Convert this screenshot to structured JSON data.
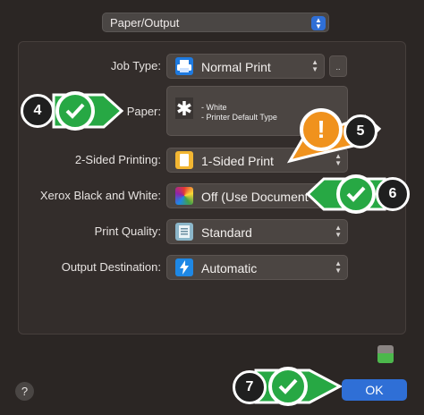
{
  "header": {
    "section_select": "Paper/Output"
  },
  "form": {
    "job_type": {
      "label": "Job Type:",
      "value": "Normal Print",
      "extra_button": ".."
    },
    "paper": {
      "label": "Paper:",
      "line1": "- White",
      "line2": "- Printer Default Type",
      "icon": "asterisk-icon"
    },
    "two_sided": {
      "label": "2-Sided Printing:",
      "value": "1-Sided Print"
    },
    "xerox_bw": {
      "label": "Xerox Black and White:",
      "value": "Off (Use Document"
    },
    "print_quality": {
      "label": "Print Quality:",
      "value": "Standard"
    },
    "output_destination": {
      "label": "Output Destination:",
      "value": "Automatic"
    }
  },
  "annotations": {
    "badge_4": "4",
    "badge_5": "5",
    "badge_6": "6",
    "badge_7": "7",
    "warning_symbol": "!"
  },
  "footer": {
    "help": "?",
    "ok": "OK"
  },
  "colors": {
    "accent": "#2f6fd6",
    "check_green": "#27a844",
    "warn_orange": "#f0921d"
  }
}
